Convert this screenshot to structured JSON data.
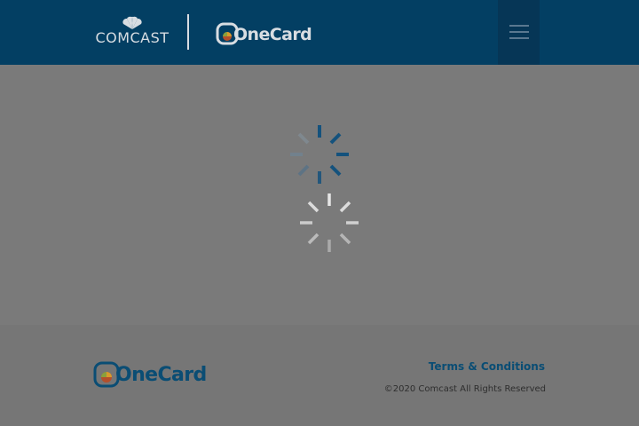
{
  "header": {
    "comcast_text": "COMCAST",
    "onecard_text": "OneCard",
    "menu_icon": "hamburger-menu-icon"
  },
  "loading": {
    "spinners": [
      "loading-spinner-blue",
      "loading-spinner-white"
    ]
  },
  "footer": {
    "onecard_text": "OneCard",
    "terms_label": "Terms & Conditions",
    "copyright": "©2020 Comcast All Rights Reserved"
  },
  "colors": {
    "header_bg": "#033f63",
    "overlay_bg": "#7a7a7a",
    "brand_blue": "#0a4d74",
    "spinner_blue": "#14527d",
    "spinner_white": "#e6e6e6"
  }
}
